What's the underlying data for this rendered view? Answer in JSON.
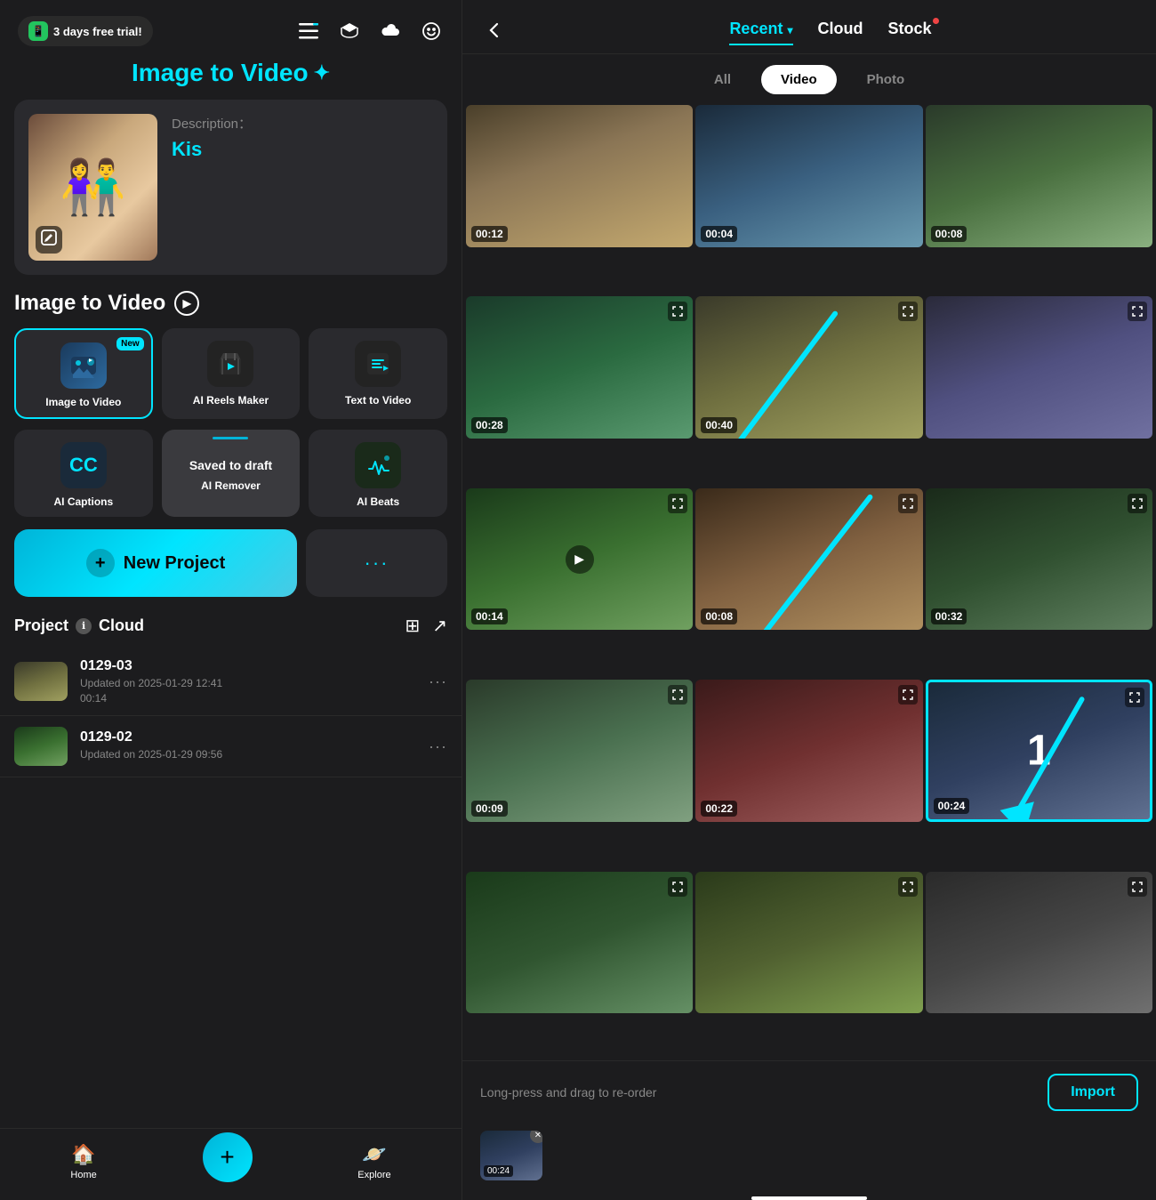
{
  "app": {
    "title_cyan": "Image to Video",
    "title_suffix": "✦",
    "trial": "3 days free trial!"
  },
  "hero": {
    "description_label": "Description：",
    "description_value": "Kis",
    "edit_icon": "✎"
  },
  "section_title": "Image to Video",
  "features_row1": [
    {
      "id": "image-to-video",
      "label": "Image to Video",
      "new": true,
      "icon": "🎬"
    },
    {
      "id": "ai-reels",
      "label": "AI Reels Maker",
      "new": false,
      "icon": "⚡"
    },
    {
      "id": "text-to-video",
      "label": "Text  to Video",
      "new": false,
      "icon": "✏️"
    }
  ],
  "features_row2": [
    {
      "id": "ai-captions",
      "label": "AI Captions",
      "icon": "CC"
    },
    {
      "id": "ai-remover",
      "label": "AI Remover",
      "draft": true
    },
    {
      "id": "ai-beats",
      "label": "AI Beats",
      "icon": "🎵"
    }
  ],
  "new_project_btn": "+ New Project",
  "more_btn": "···",
  "project_header": {
    "title": "Project",
    "cloud": "Cloud"
  },
  "projects": [
    {
      "name": "0129-03",
      "date": "Updated on 2025-01-29 12:41",
      "duration": "00:14"
    },
    {
      "name": "0129-02",
      "date": "Updated on 2025-01-29 09:56",
      "duration": ""
    }
  ],
  "nav": {
    "home": "Home",
    "explore": "Explore"
  },
  "right": {
    "tabs": [
      "Recent",
      "Cloud",
      "Stock"
    ],
    "active_tab": "Recent",
    "filters": [
      "All",
      "Video",
      "Photo"
    ],
    "active_filter": "Video"
  },
  "videos": [
    {
      "id": 1,
      "duration": "00:12",
      "cls": "vt1"
    },
    {
      "id": 2,
      "duration": "00:04",
      "cls": "vt2"
    },
    {
      "id": 3,
      "duration": "00:08",
      "cls": "vt3"
    },
    {
      "id": 4,
      "duration": "00:28",
      "cls": "vt4",
      "has_expand": true
    },
    {
      "id": 5,
      "duration": "00:40",
      "cls": "vt5",
      "has_expand": true,
      "has_arrow": true
    },
    {
      "id": 6,
      "duration": "",
      "cls": "vt6",
      "has_expand": true
    },
    {
      "id": 7,
      "duration": "00:14",
      "cls": "vt7",
      "has_expand": true
    },
    {
      "id": 8,
      "duration": "00:08",
      "cls": "vt8",
      "has_expand": true
    },
    {
      "id": 9,
      "duration": "00:32",
      "cls": "vt9",
      "has_expand": true
    },
    {
      "id": 10,
      "duration": "00:09",
      "cls": "vt10",
      "has_expand": true
    },
    {
      "id": 11,
      "duration": "00:22",
      "cls": "vt11",
      "has_expand": true
    },
    {
      "id": 12,
      "duration": "00:24",
      "cls": "vt12",
      "selected": true,
      "selected_num": "1",
      "has_expand": true
    },
    {
      "id": 13,
      "duration": "",
      "cls": "vt13",
      "has_expand": true
    },
    {
      "id": 14,
      "duration": "",
      "cls": "vt14",
      "has_expand": true
    },
    {
      "id": 15,
      "duration": "",
      "cls": "vt15",
      "has_expand": true
    }
  ],
  "bottom": {
    "drag_hint": "Long-press and drag to re-order",
    "import_btn": "Import"
  },
  "selected_preview": {
    "duration": "00:24"
  }
}
